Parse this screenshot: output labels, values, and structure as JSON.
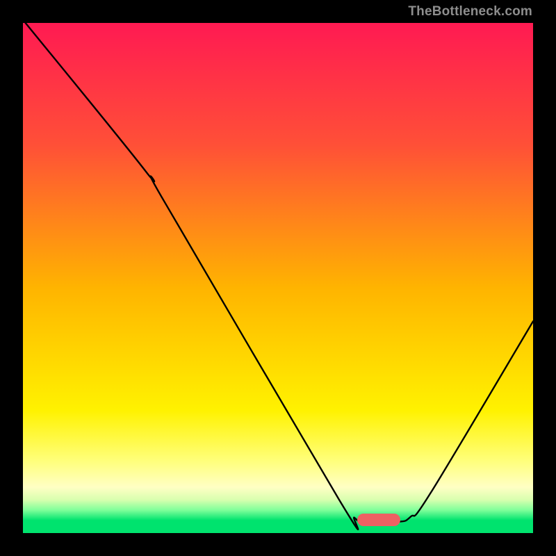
{
  "watermark": "TheBottleneck.com",
  "chart_data": {
    "type": "line",
    "title": "",
    "xlabel": "",
    "ylabel": "",
    "xlim": [
      0,
      100
    ],
    "ylim": [
      0,
      100
    ],
    "grid": false,
    "legend": false,
    "gradient_stops": [
      {
        "pct": 0,
        "color": "#ff1a52"
      },
      {
        "pct": 24,
        "color": "#ff5037"
      },
      {
        "pct": 52,
        "color": "#ffb400"
      },
      {
        "pct": 76,
        "color": "#fff200"
      },
      {
        "pct": 86,
        "color": "#ffff7d"
      },
      {
        "pct": 91,
        "color": "#ffffc4"
      },
      {
        "pct": 93.5,
        "color": "#d8ffaf"
      },
      {
        "pct": 95.5,
        "color": "#7fff9a"
      },
      {
        "pct": 97.5,
        "color": "#00e36e"
      },
      {
        "pct": 100,
        "color": "#00e36e"
      }
    ],
    "series": [
      {
        "name": "curve",
        "points": [
          {
            "x": 0.5,
            "y": 100.0
          },
          {
            "x": 24.0,
            "y": 71.0
          },
          {
            "x": 28.0,
            "y": 64.5
          },
          {
            "x": 62.0,
            "y": 6.5
          },
          {
            "x": 65.0,
            "y": 3.0
          },
          {
            "x": 67.0,
            "y": 2.2
          },
          {
            "x": 73.5,
            "y": 2.2
          },
          {
            "x": 76.0,
            "y": 3.2
          },
          {
            "x": 80.0,
            "y": 8.0
          },
          {
            "x": 100.0,
            "y": 41.5
          }
        ]
      }
    ],
    "marker": {
      "x_start": 65.5,
      "x_end": 74.0,
      "y": 2.55
    },
    "annotations": []
  }
}
